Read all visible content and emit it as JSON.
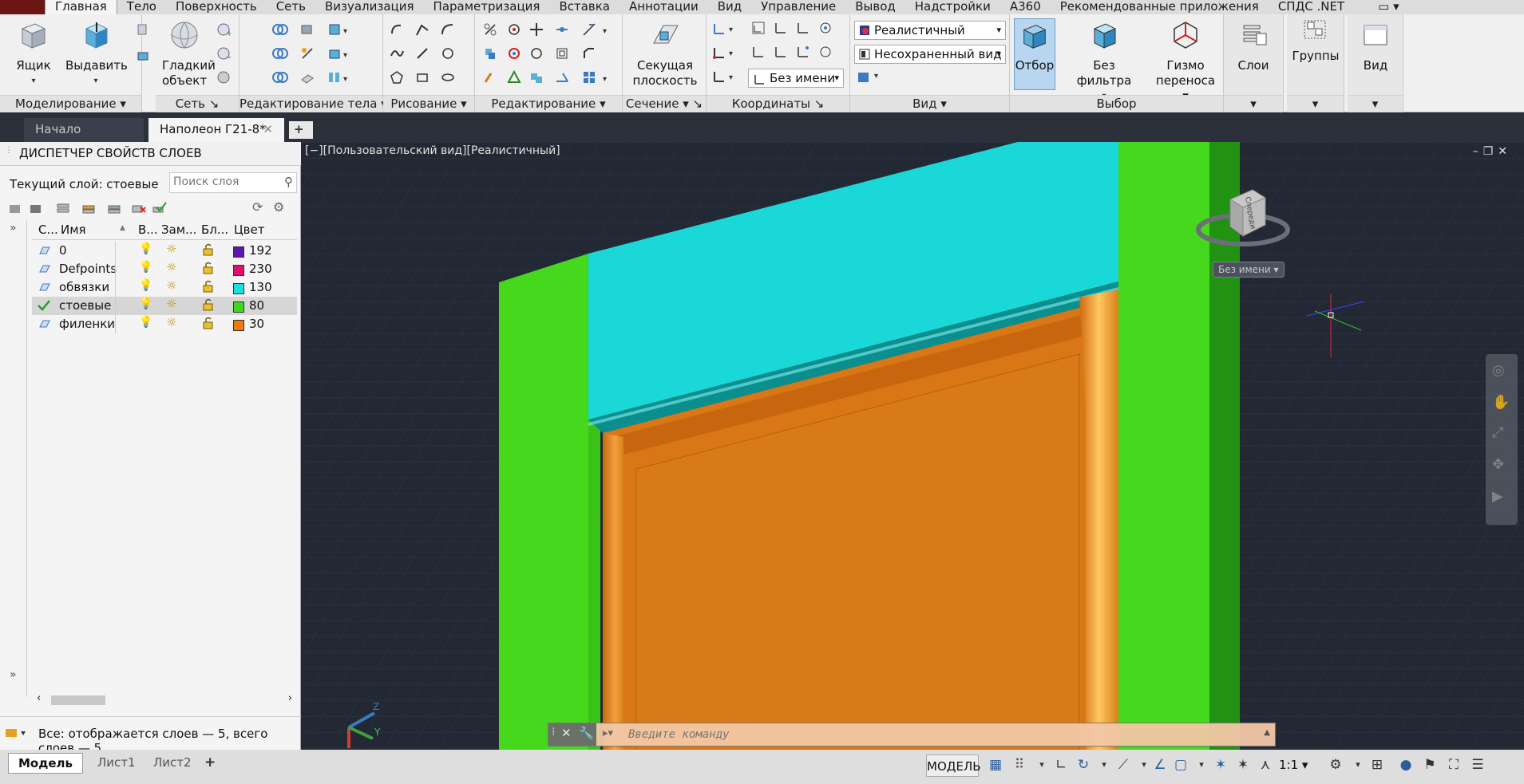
{
  "menu": {
    "tabs": [
      "Главная",
      "Тело",
      "Поверхность",
      "Сеть",
      "Визуализация",
      "Параметризация",
      "Вставка",
      "Аннотации",
      "Вид",
      "Управление",
      "Вывод",
      "Надстройки",
      "A360",
      "Рекомендованные приложения",
      "СПДС .NET"
    ]
  },
  "ribbon": {
    "modeling": {
      "title": "Моделирование",
      "box": "Ящик",
      "extrude": "Выдавить"
    },
    "mesh": {
      "title": "Сеть",
      "smooth_line1": "Гладкий",
      "smooth_line2": "объект"
    },
    "solid_edit": {
      "title": "Редактирование тела"
    },
    "draw": {
      "title": "Рисование"
    },
    "edit": {
      "title": "Редактирование"
    },
    "section": {
      "title": "Сечение",
      "plane_line1": "Секущая",
      "plane_line2": "плоскость"
    },
    "coords": {
      "title": "Координаты",
      "ucs_combo": "Без имени"
    },
    "view": {
      "title": "Вид",
      "visual_style": "Реалистичный",
      "named_view": "Несохраненный вид"
    },
    "selection": {
      "title": "Выбор",
      "culling": "Отбор",
      "no_filter": "Без фильтра",
      "gizmo_line1": "Гизмо",
      "gizmo_line2": "переноса"
    },
    "layers": {
      "title": "Слои"
    },
    "groups": {
      "title": "Группы"
    },
    "view_panel": {
      "title": "Вид"
    }
  },
  "doc_tabs": {
    "start": "Начало",
    "current": "Наполеон Г21-8*"
  },
  "layer_manager": {
    "title": "ДИСПЕТЧЕР СВОЙСТВ СЛОЕВ",
    "current_layer": "Текущий слой: стоевые",
    "search_placeholder": "Поиск слоя",
    "columns": {
      "status": "С...",
      "name": "Имя",
      "on": "В...",
      "freeze": "Зам...",
      "lock": "Бл...",
      "color": "Цвет"
    },
    "layers": [
      {
        "name": "0",
        "color_index": "192",
        "color": "#5a18b0"
      },
      {
        "name": "Defpoints",
        "color_index": "230",
        "color": "#e0106a"
      },
      {
        "name": "обвязки",
        "color_index": "130",
        "color": "#1ae0e0"
      },
      {
        "name": "стоевые",
        "color_index": "80",
        "color": "#3fd81a"
      },
      {
        "name": "филенки",
        "color_index": "30",
        "color": "#f07a10"
      }
    ],
    "summary": "Все: отображается слоев — 5, всего слоев — 5"
  },
  "viewport": {
    "label": "[−][Пользовательский вид][Реалистичный]",
    "ucs_badge": "Без имени",
    "command_placeholder": "Введите команду",
    "viewcube_text": "Спереди",
    "colors": {
      "stile": "#45d81c",
      "rail": "#1ad8d8",
      "panel": "#d97716",
      "background": "#232934"
    }
  },
  "statusbar": {
    "tabs": [
      "Модель",
      "Лист1",
      "Лист2"
    ],
    "mode": "МОДЕЛЬ",
    "scale": "1:1"
  }
}
